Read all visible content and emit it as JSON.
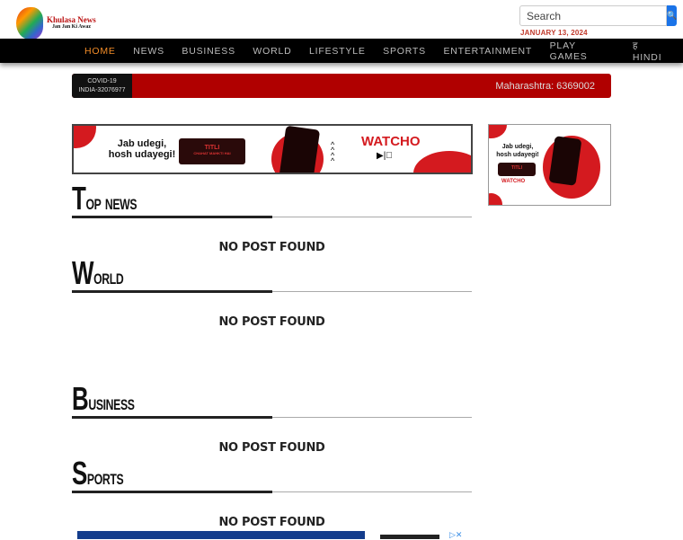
{
  "brand": {
    "name": "Khulasa News",
    "tagline": "Jan Jan Ki Awaz"
  },
  "search": {
    "placeholder": "Search",
    "icon": "search-icon"
  },
  "date": "JANUARY 13, 2024",
  "nav": {
    "items": [
      "HOME",
      "NEWS",
      "BUSINESS",
      "WORLD",
      "LIFESTYLE",
      "SPORTS",
      "ENTERTAINMENT",
      "PLAY GAMES",
      "ह HINDI"
    ],
    "active": "HOME"
  },
  "ticker": {
    "label1": "COVID-19",
    "label2": "INDIA-32076977",
    "message": "Maharashtra: 6369002"
  },
  "ads": {
    "banner_text": "Jab udegi, hosh udayegi!",
    "show": "TITLI",
    "show_sub": "CHAHAT MAHKTI HAI",
    "brand": "WATCHO"
  },
  "sections": [
    {
      "title": "Top news",
      "empty": "NO POST FOUND"
    },
    {
      "title": "World",
      "empty": "NO POST FOUND"
    },
    {
      "title": "Business",
      "empty": "NO POST FOUND"
    },
    {
      "title": "Sports",
      "empty": "NO POST FOUND"
    }
  ],
  "colors": {
    "accent": "#f28c28",
    "ticker": "#b00000",
    "date": "#c0392b",
    "search_button": "#1a73e8"
  }
}
